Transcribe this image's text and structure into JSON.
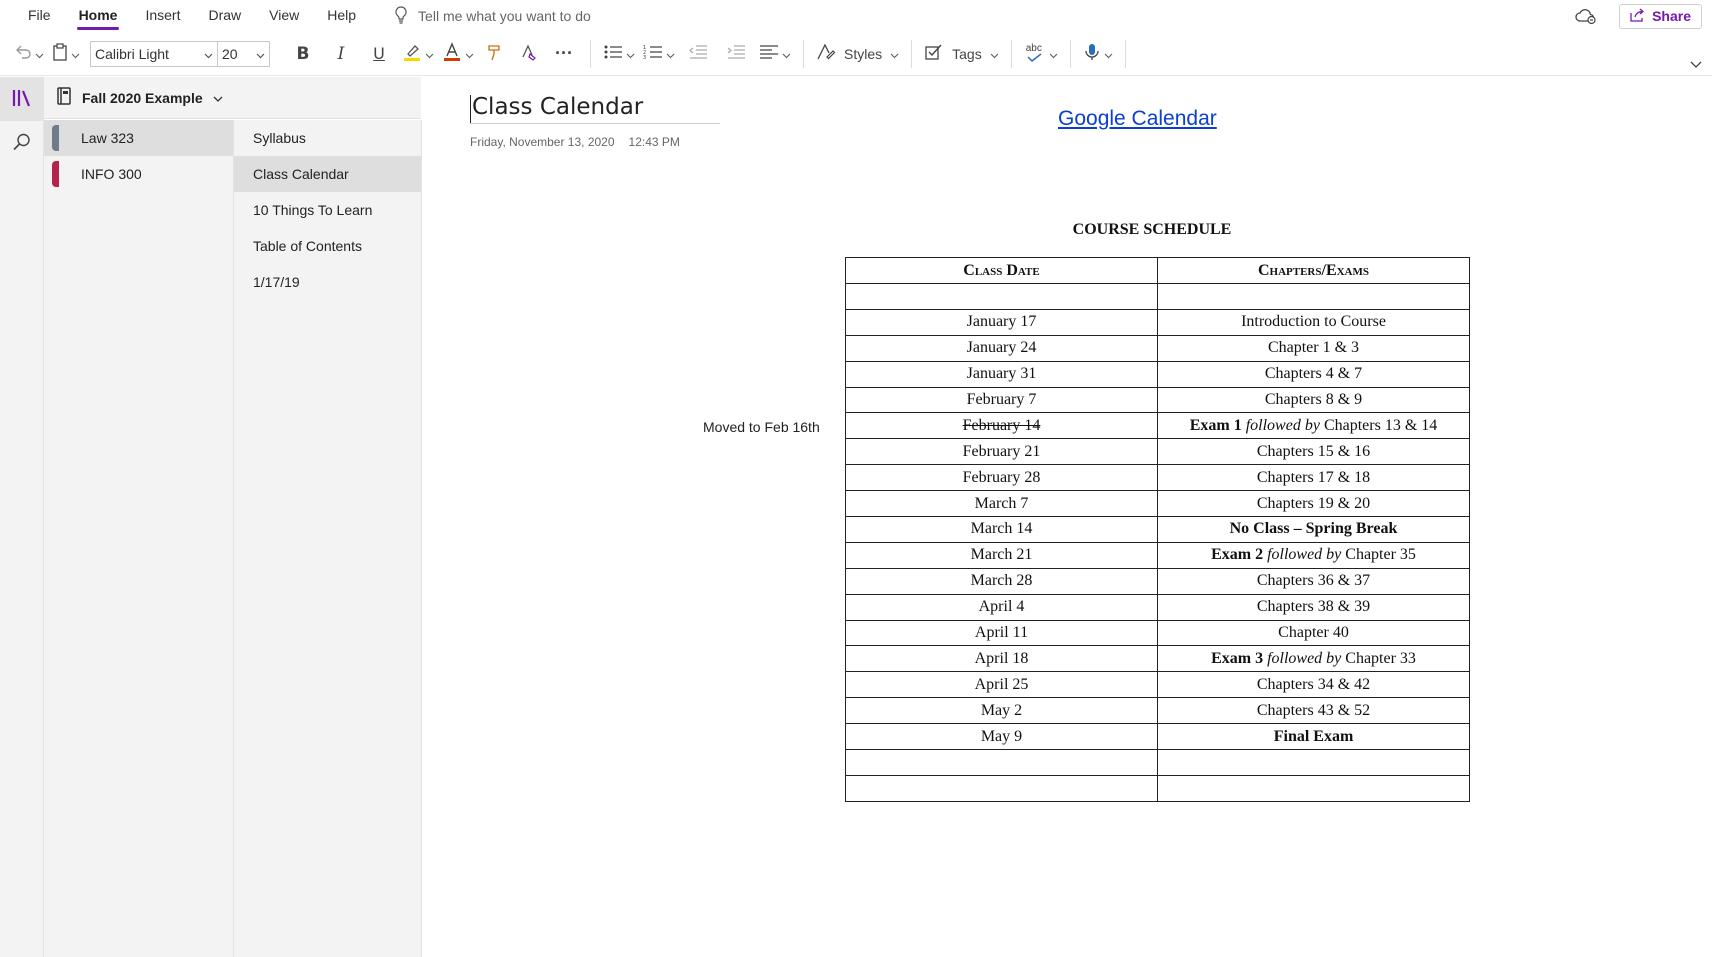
{
  "menu": {
    "items": [
      "File",
      "Home",
      "Insert",
      "Draw",
      "View",
      "Help"
    ],
    "active": "Home",
    "tell_me": "Tell me what you want to do",
    "share_label": "Share"
  },
  "ribbon": {
    "font_name": "Calibri Light",
    "font_size": "20",
    "bold": "B",
    "italic": "I",
    "underline": "U",
    "more": "···",
    "styles_label": "Styles",
    "tags_label": "Tags",
    "spell_label": "abc"
  },
  "colors": {
    "accent": "#7719aa",
    "section_law": "#6e7b88",
    "section_info": "#b4234b",
    "font_color": "#d83b01",
    "highlight": "#f5d800",
    "link": "#0b3fd1"
  },
  "notebook": {
    "name": "Fall 2020 Example",
    "sections": [
      {
        "label": "Law 323",
        "active": true
      },
      {
        "label": "INFO 300",
        "active": false
      }
    ],
    "pages": [
      {
        "label": "Syllabus",
        "active": false
      },
      {
        "label": "Class Calendar",
        "active": true
      },
      {
        "label": "10 Things To Learn",
        "active": false
      },
      {
        "label": "Table of Contents",
        "active": false
      },
      {
        "label": "1/17/19",
        "active": false
      }
    ]
  },
  "page": {
    "title": "Class Calendar",
    "date": "Friday, November 13, 2020",
    "time": "12:43 PM",
    "link_text": "Google Calendar",
    "side_note": "Moved to Feb 16th"
  },
  "schedule": {
    "title": "COURSE SCHEDULE",
    "headers": [
      "Class Date",
      "Chapters/Exams"
    ],
    "rows": [
      {
        "date": "",
        "content": []
      },
      {
        "date": "January 17",
        "content": [
          {
            "t": "Introduction to Course"
          }
        ]
      },
      {
        "date": "January 24",
        "content": [
          {
            "t": "Chapter 1 & 3"
          }
        ]
      },
      {
        "date": "January 31",
        "content": [
          {
            "t": "Chapters 4 & 7"
          }
        ]
      },
      {
        "date": "February 7",
        "content": [
          {
            "t": "Chapters 8 & 9"
          }
        ]
      },
      {
        "date": "February 14",
        "strike": true,
        "content": [
          {
            "t": "Exam 1",
            "s": "b"
          },
          {
            "t": " "
          },
          {
            "t": "followed by",
            "s": "i"
          },
          {
            "t": " Chapters 13 & 14"
          }
        ]
      },
      {
        "date": "February 21",
        "content": [
          {
            "t": "Chapters 15 & 16"
          }
        ]
      },
      {
        "date": "February 28",
        "content": [
          {
            "t": "Chapters 17 & 18"
          }
        ]
      },
      {
        "date": "March 7",
        "content": [
          {
            "t": "Chapters 19 & 20"
          }
        ]
      },
      {
        "date": "March 14",
        "content": [
          {
            "t": "No Class – Spring Break",
            "s": "b"
          }
        ]
      },
      {
        "date": "March 21",
        "content": [
          {
            "t": "Exam 2",
            "s": "b"
          },
          {
            "t": " "
          },
          {
            "t": "followed by",
            "s": "i"
          },
          {
            "t": " Chapter 35"
          }
        ]
      },
      {
        "date": "March 28",
        "content": [
          {
            "t": "Chapters 36 & 37"
          }
        ]
      },
      {
        "date": "April 4",
        "content": [
          {
            "t": "Chapters 38 & 39"
          }
        ]
      },
      {
        "date": "April 11",
        "content": [
          {
            "t": "Chapter 40"
          }
        ]
      },
      {
        "date": "April 18",
        "content": [
          {
            "t": "Exam 3",
            "s": "b"
          },
          {
            "t": " "
          },
          {
            "t": "followed by",
            "s": "i"
          },
          {
            "t": " Chapter 33"
          }
        ]
      },
      {
        "date": "April 25",
        "content": [
          {
            "t": "Chapters 34 & 42"
          }
        ]
      },
      {
        "date": "May 2",
        "content": [
          {
            "t": "Chapters 43 & 52"
          }
        ]
      },
      {
        "date": "May 9",
        "content": [
          {
            "t": "Final Exam",
            "s": "b"
          }
        ]
      },
      {
        "date": "",
        "content": []
      },
      {
        "date": "",
        "content": []
      }
    ]
  }
}
